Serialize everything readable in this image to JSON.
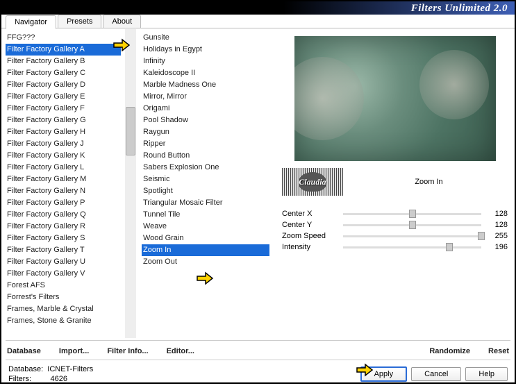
{
  "app": {
    "title": "Filters Unlimited 2.0"
  },
  "tabs": {
    "navigator": "Navigator",
    "presets": "Presets",
    "about": "About"
  },
  "col1": [
    "FFG???",
    "Filter Factory Gallery A",
    "Filter Factory Gallery B",
    "Filter Factory Gallery C",
    "Filter Factory Gallery D",
    "Filter Factory Gallery E",
    "Filter Factory Gallery F",
    "Filter Factory Gallery G",
    "Filter Factory Gallery H",
    "Filter Factory Gallery J",
    "Filter Factory Gallery K",
    "Filter Factory Gallery L",
    "Filter Factory Gallery M",
    "Filter Factory Gallery N",
    "Filter Factory Gallery P",
    "Filter Factory Gallery Q",
    "Filter Factory Gallery R",
    "Filter Factory Gallery S",
    "Filter Factory Gallery T",
    "Filter Factory Gallery U",
    "Filter Factory Gallery V",
    "Forest AFS",
    "Forrest's Filters",
    "Frames, Marble & Crystal",
    "Frames, Stone & Granite"
  ],
  "col1_selected": 1,
  "col2": [
    "Gunsite",
    "Holidays in Egypt",
    "Infinity",
    "Kaleidoscope II",
    "Marble Madness One",
    "Mirror, Mirror",
    "Origami",
    "Pool Shadow",
    "Raygun",
    "Ripper",
    "Round Button",
    "Sabers Explosion One",
    "Seismic",
    "Spotlight",
    "Triangular Mosaic Filter",
    "Tunnel Tile",
    "Weave",
    "Wood Grain",
    "Zoom In",
    "Zoom Out"
  ],
  "col2_selected": 18,
  "watermark_text": "Claudia",
  "filter_name": "Zoom In",
  "params": [
    {
      "label": "Center X",
      "value": "128",
      "pos": 50
    },
    {
      "label": "Center Y",
      "value": "128",
      "pos": 50
    },
    {
      "label": "Zoom Speed",
      "value": "255",
      "pos": 100
    },
    {
      "label": "Intensity",
      "value": "196",
      "pos": 77
    }
  ],
  "actions": {
    "database": "Database",
    "import": "Import...",
    "filter_info": "Filter Info...",
    "editor": "Editor...",
    "randomize": "Randomize",
    "reset": "Reset",
    "apply": "Apply",
    "cancel": "Cancel",
    "help": "Help"
  },
  "footer": {
    "db_label": "Database:",
    "db_value": "ICNET-Filters",
    "filters_label": "Filters:",
    "filters_value": "4626"
  }
}
